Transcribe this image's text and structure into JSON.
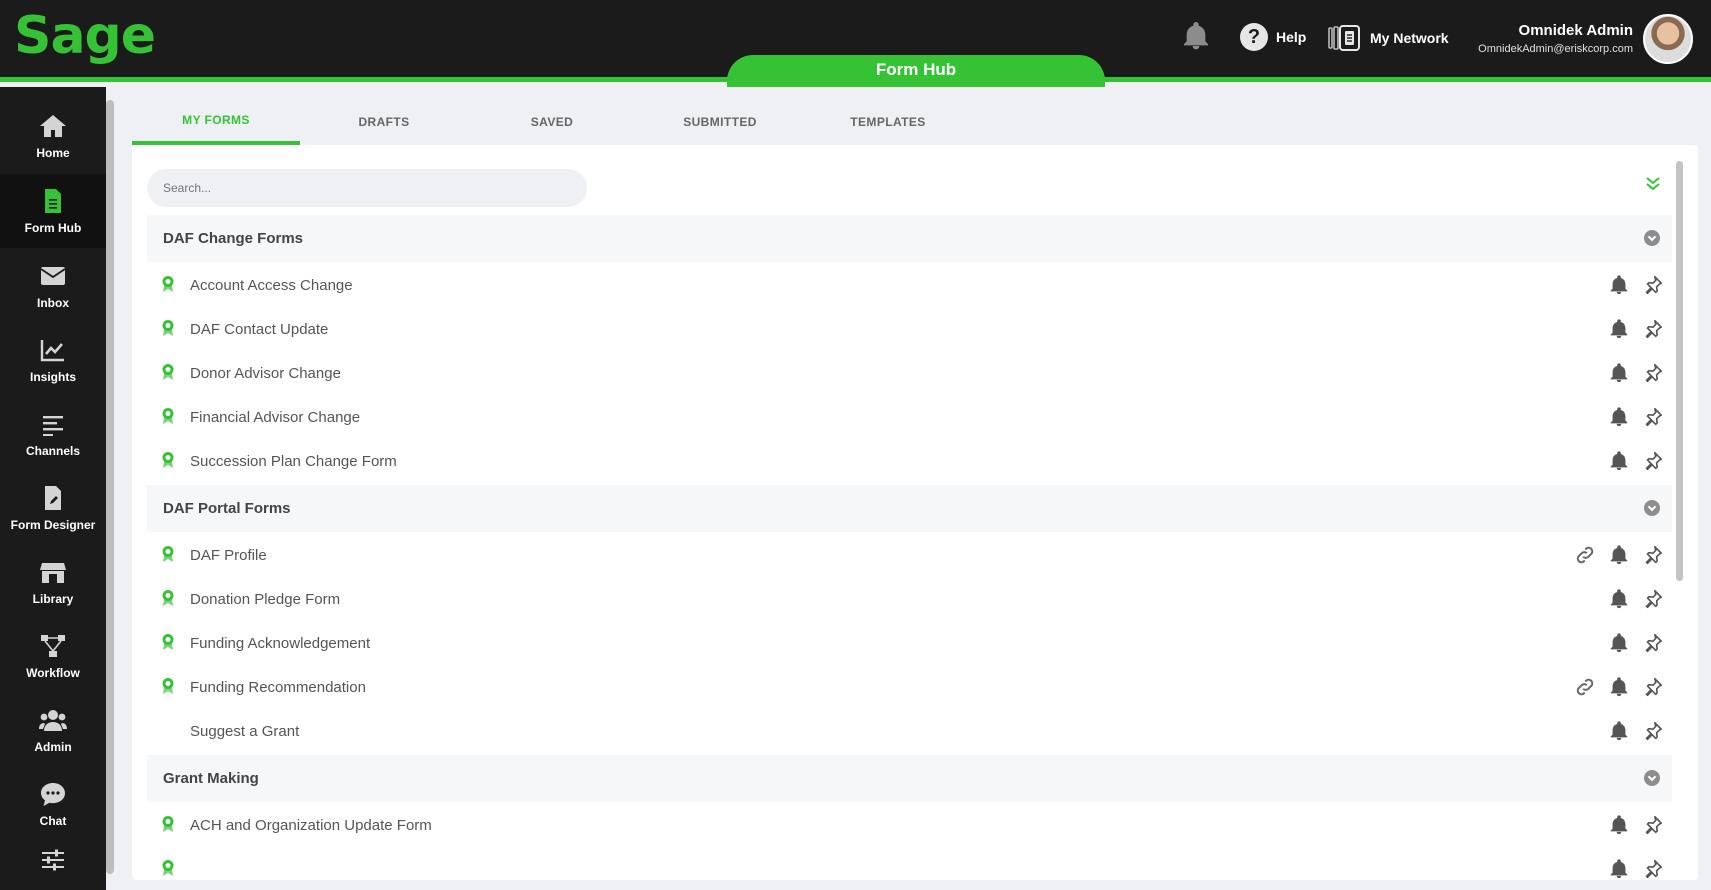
{
  "brand": {
    "logo_text": "Sage",
    "accent": "#35c335",
    "dark": "#1b1b1b"
  },
  "header": {
    "active_module": "Form Hub",
    "notifications_icon": "bell-icon",
    "help_label": "Help",
    "network_label": "My Network",
    "user": {
      "name": "Omnidek Admin",
      "email": "OmnidekAdmin@eriskcorp.com"
    }
  },
  "sidebar": {
    "items": [
      {
        "label": "Home",
        "icon": "home-icon"
      },
      {
        "label": "Form Hub",
        "icon": "form-icon",
        "active": true
      },
      {
        "label": "Inbox",
        "icon": "mail-icon"
      },
      {
        "label": "Insights",
        "icon": "chart-icon"
      },
      {
        "label": "Channels",
        "icon": "channels-icon"
      },
      {
        "label": "Form Designer",
        "icon": "form-designer-icon"
      },
      {
        "label": "Library",
        "icon": "store-icon"
      },
      {
        "label": "Workflow",
        "icon": "workflow-icon"
      },
      {
        "label": "Admin",
        "icon": "users-icon"
      },
      {
        "label": "Chat",
        "icon": "chat-icon"
      },
      {
        "label": "",
        "icon": "settings-sliders-icon"
      }
    ]
  },
  "tabs": [
    "MY FORMS",
    "DRAFTS",
    "SAVED",
    "SUBMITTED",
    "TEMPLATES"
  ],
  "search": {
    "placeholder": "Search..."
  },
  "groups": [
    {
      "title": "DAF Change Forms",
      "forms": [
        {
          "label": "Account Access Change",
          "badge": true,
          "link": false
        },
        {
          "label": "DAF Contact Update",
          "badge": true,
          "link": false
        },
        {
          "label": "Donor Advisor Change",
          "badge": true,
          "link": false
        },
        {
          "label": "Financial Advisor Change",
          "badge": true,
          "link": false
        },
        {
          "label": "Succession Plan Change Form",
          "badge": true,
          "link": false
        }
      ]
    },
    {
      "title": "DAF Portal Forms",
      "forms": [
        {
          "label": "DAF Profile",
          "badge": true,
          "link": true
        },
        {
          "label": "Donation Pledge Form",
          "badge": true,
          "link": false
        },
        {
          "label": "Funding Acknowledgement",
          "badge": true,
          "link": false
        },
        {
          "label": "Funding Recommendation",
          "badge": true,
          "link": true
        },
        {
          "label": "Suggest a Grant",
          "badge": false,
          "link": false
        }
      ]
    },
    {
      "title": "Grant Making",
      "forms": [
        {
          "label": "ACH and Organization Update Form",
          "badge": true,
          "link": false
        }
      ]
    }
  ]
}
